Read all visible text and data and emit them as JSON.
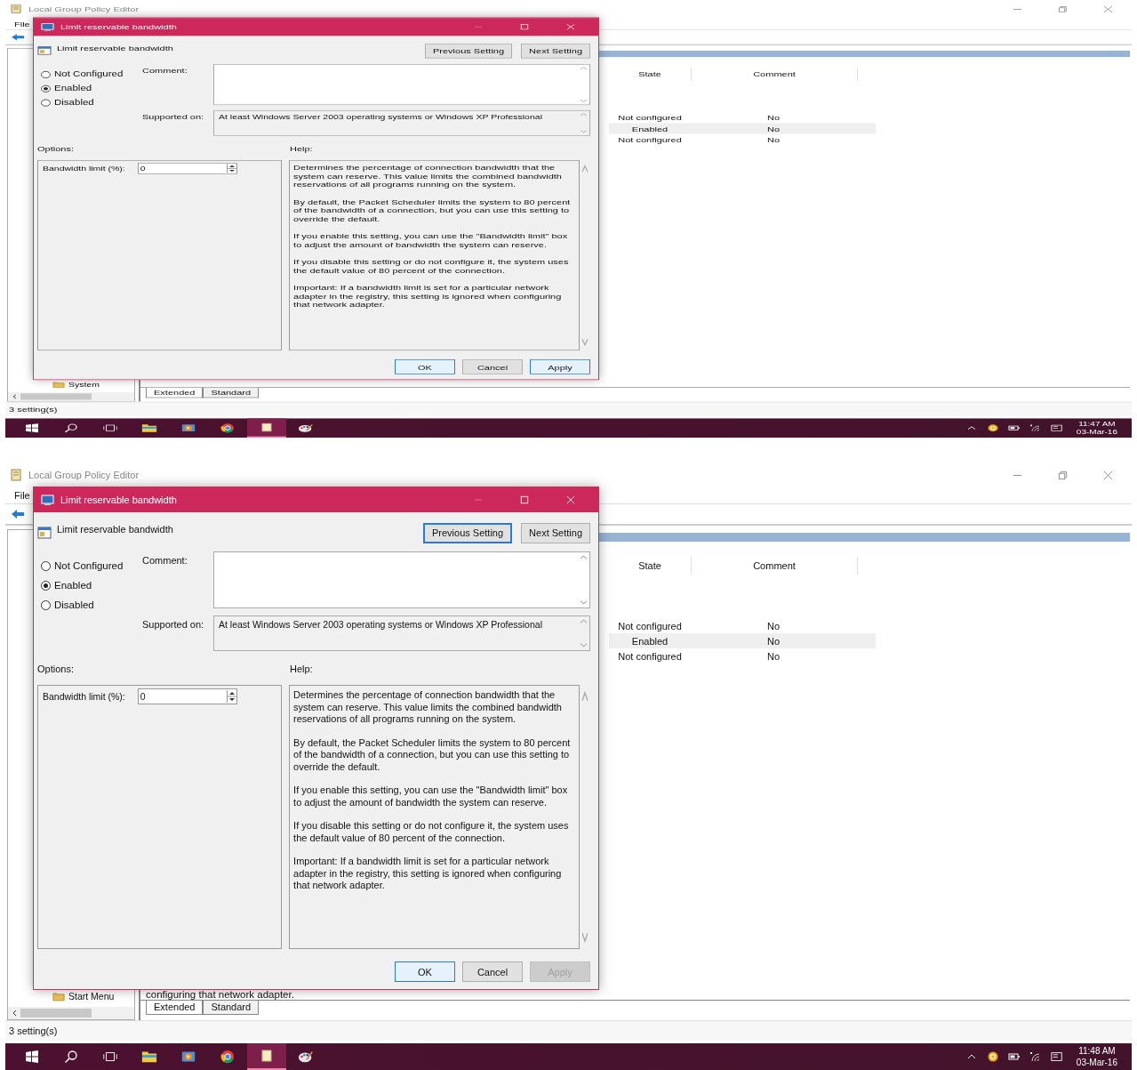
{
  "screens": [
    {
      "kind": "squashed",
      "app_title": "Local Group Policy Editor",
      "menu": [
        "File"
      ],
      "tree_items": [
        {
          "label": "System"
        }
      ],
      "list": {
        "columns": [
          "State",
          "Comment"
        ],
        "rows": [
          {
            "state": "Not configured",
            "comment": "No",
            "selected": false
          },
          {
            "state": "Enabled",
            "comment": "No",
            "selected": true
          },
          {
            "state": "Not configured",
            "comment": "No",
            "selected": false
          }
        ]
      },
      "view_tabs": [
        {
          "label": "Extended",
          "selected": true
        },
        {
          "label": "Standard",
          "selected": false
        }
      ],
      "status": "3 setting(s)",
      "dialog": {
        "title": "Limit reservable bandwidth",
        "policy_name": "Limit reservable bandwidth",
        "nav_buttons": [
          {
            "label": "Previous Setting",
            "focused": false
          },
          {
            "label": "Next Setting",
            "focused": false
          }
        ],
        "radios": [
          {
            "label": "Not Configured",
            "selected": false
          },
          {
            "label": "Enabled",
            "selected": true
          },
          {
            "label": "Disabled",
            "selected": false
          }
        ],
        "comment_label": "Comment:",
        "supported_label": "Supported on:",
        "supported_text": "At least Windows Server 2003 operating systems or Windows XP Professional",
        "options_label": "Options:",
        "help_label": "Help:",
        "option_fields": [
          {
            "label": "Bandwidth limit (%):",
            "value": "0"
          }
        ],
        "help_paragraphs": [
          "Determines the percentage of connection bandwidth that the system can reserve. This value limits the combined bandwidth reservations of all programs running on the system.",
          "By default, the Packet Scheduler limits the system to 80 percent of the bandwidth of a connection, but you can use this setting to override the default.",
          "If you enable this setting, you can use the \"Bandwidth limit\" box to adjust the amount of bandwidth the system can reserve.",
          "If you disable this setting or do not configure it, the system uses the default value of 80 percent of the connection.",
          "Important: If a bandwidth limit is set for a particular network adapter in the registry, this setting is ignored when configuring that network adapter."
        ],
        "buttons": [
          {
            "label": "OK",
            "default": true,
            "hovered": false,
            "disabled": false
          },
          {
            "label": "Cancel",
            "default": false,
            "hovered": false,
            "disabled": false
          },
          {
            "label": "Apply",
            "default": false,
            "hovered": true,
            "disabled": false
          }
        ]
      },
      "clock": {
        "time": "11:47 AM",
        "date": "03-Mar-16"
      }
    },
    {
      "kind": "normal",
      "app_title": "Local Group Policy Editor",
      "menu": [
        "File"
      ],
      "tree_items": [
        {
          "label": "Start Menu"
        }
      ],
      "list": {
        "columns": [
          "State",
          "Comment"
        ],
        "rows": [
          {
            "state": "Not configured",
            "comment": "No",
            "selected": false
          },
          {
            "state": "Enabled",
            "comment": "No",
            "selected": true
          },
          {
            "state": "Not configured",
            "comment": "No",
            "selected": false
          }
        ]
      },
      "description_tail": "configuring that network adapter.",
      "view_tabs": [
        {
          "label": "Extended",
          "selected": true
        },
        {
          "label": "Standard",
          "selected": false
        }
      ],
      "status": "3 setting(s)",
      "dialog": {
        "title": "Limit reservable bandwidth",
        "policy_name": "Limit reservable bandwidth",
        "nav_buttons": [
          {
            "label": "Previous Setting",
            "focused": true
          },
          {
            "label": "Next Setting",
            "focused": false
          }
        ],
        "radios": [
          {
            "label": "Not Configured",
            "selected": false
          },
          {
            "label": "Enabled",
            "selected": true
          },
          {
            "label": "Disabled",
            "selected": false
          }
        ],
        "comment_label": "Comment:",
        "supported_label": "Supported on:",
        "supported_text": "At least Windows Server 2003 operating systems or Windows XP Professional",
        "options_label": "Options:",
        "help_label": "Help:",
        "option_fields": [
          {
            "label": "Bandwidth limit (%):",
            "value": "0"
          }
        ],
        "help_paragraphs": [
          "Determines the percentage of connection bandwidth that the system can reserve. This value limits the combined bandwidth reservations of all programs running on the system.",
          "By default, the Packet Scheduler limits the system to 80 percent of the bandwidth of a connection, but you can use this setting to override the default.",
          "If you enable this setting, you can use the \"Bandwidth limit\" box to adjust the amount of bandwidth the system can reserve.",
          "If you disable this setting or do not configure it, the system uses the default value of 80 percent of the connection.",
          "Important: If a bandwidth limit is set for a particular network adapter in the registry, this setting is ignored when configuring that network adapter."
        ],
        "buttons": [
          {
            "label": "OK",
            "default": true,
            "hovered": false,
            "disabled": false
          },
          {
            "label": "Cancel",
            "default": false,
            "hovered": false,
            "disabled": false
          },
          {
            "label": "Apply",
            "default": false,
            "hovered": false,
            "disabled": true
          }
        ]
      },
      "clock": {
        "time": "11:48 AM",
        "date": "03-Mar-16"
      }
    }
  ]
}
